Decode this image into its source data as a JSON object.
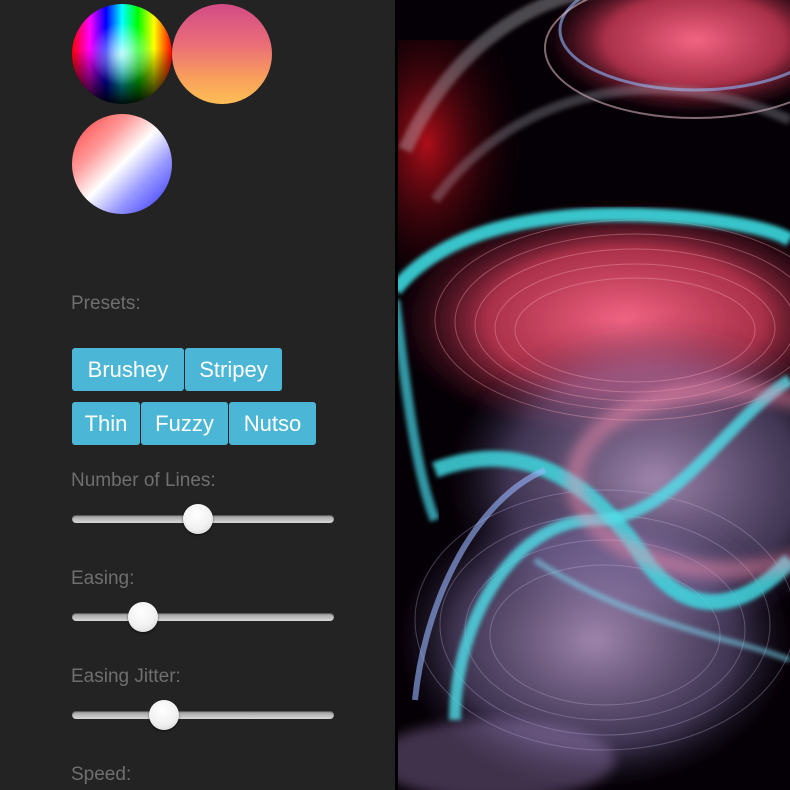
{
  "swatches": [
    {
      "name": "rainbow",
      "colors": [
        "#ff0000",
        "#ff00ff",
        "#0000ff",
        "#00ffff",
        "#00ff00",
        "#ffff00"
      ]
    },
    {
      "name": "sunset",
      "colors": [
        "#d24b86",
        "#ea6d78",
        "#f9a05b",
        "#ffbe55"
      ]
    },
    {
      "name": "red-white-blue",
      "colors": [
        "#ff3b3b",
        "#ffffff",
        "#2a2aff"
      ]
    }
  ],
  "presets": {
    "label": "Presets:",
    "buttons": [
      "Brushey",
      "Stripey",
      "Thin",
      "Fuzzy",
      "Nutso"
    ],
    "color": "#4cb6d6"
  },
  "sliders": [
    {
      "label": "Number of Lines:",
      "value": 0.48
    },
    {
      "label": "Easing:",
      "value": 0.27
    },
    {
      "label": "Easing Jitter:",
      "value": 0.35
    },
    {
      "label": "Speed:"
    }
  ],
  "colors": {
    "sidebar_bg": "#232323",
    "label_text": "#6f6f6f",
    "accent": "#4cb6d6"
  }
}
